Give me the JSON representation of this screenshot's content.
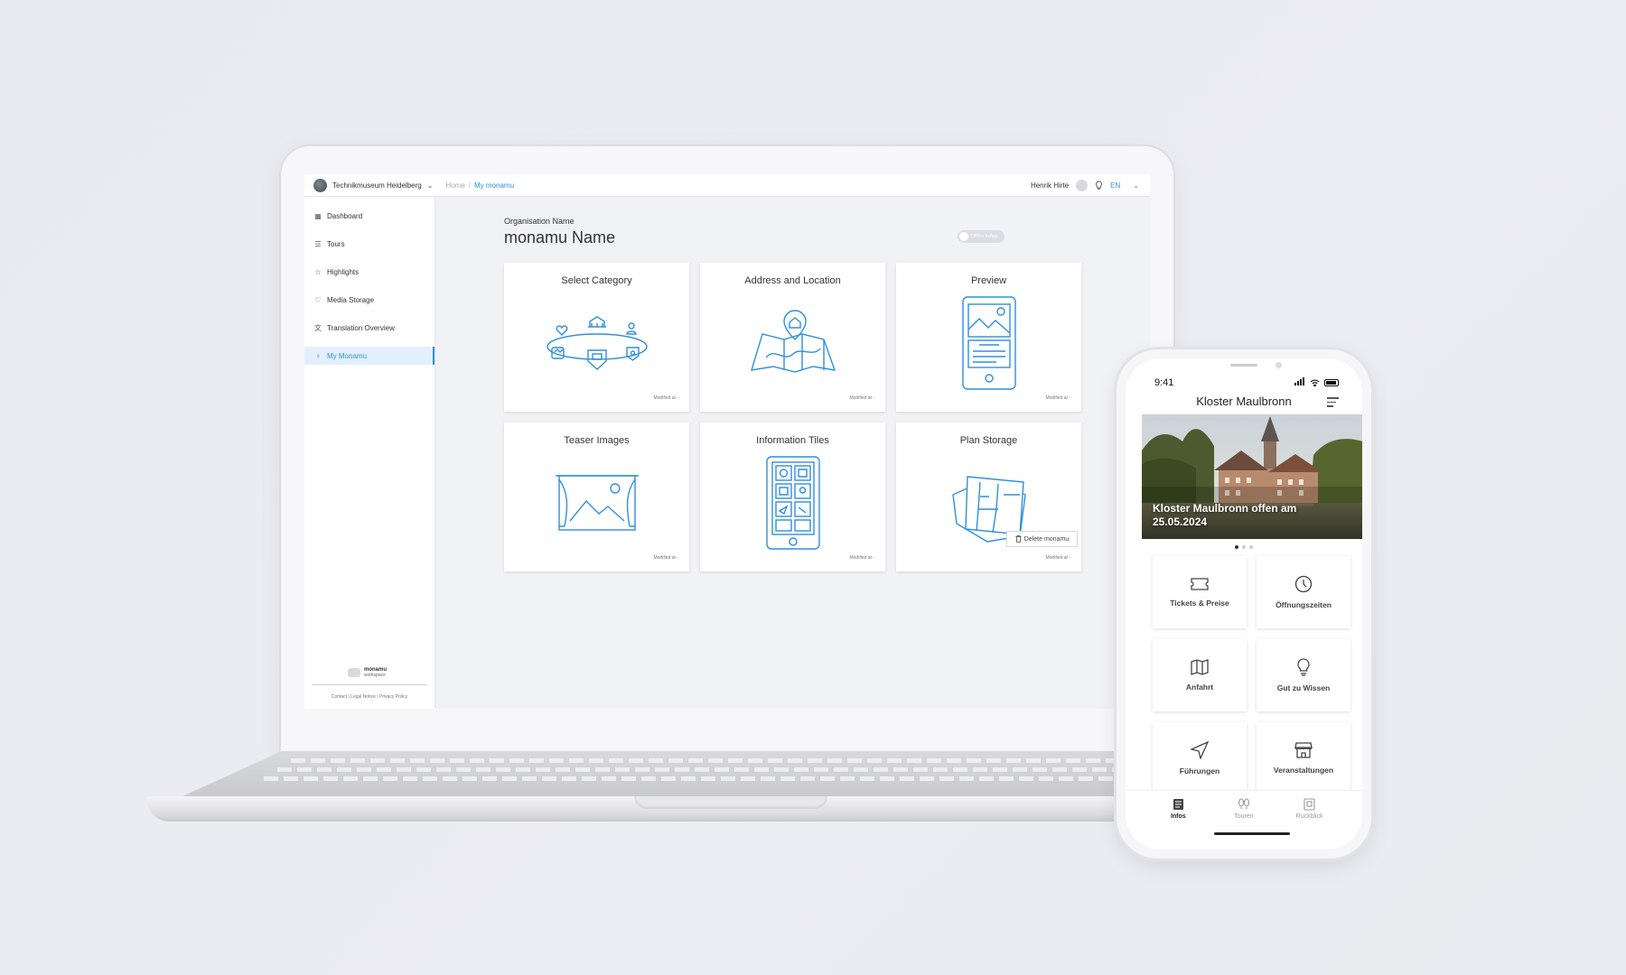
{
  "laptop": {
    "header": {
      "org_name": "Technikmuseum Heidelberg",
      "breadcrumb_home": "Home",
      "breadcrumb_sep": "/",
      "breadcrumb_current": "My monamu",
      "user_name": "Henrik Hirte",
      "language": "EN"
    },
    "sidebar": {
      "items": [
        {
          "label": "Dashboard",
          "icon": "grid-icon"
        },
        {
          "label": "Tours",
          "icon": "list-icon"
        },
        {
          "label": "Highlights",
          "icon": "star-icon"
        },
        {
          "label": "Media Storage",
          "icon": "heart-icon"
        },
        {
          "label": "Translation Overview",
          "icon": "translate-icon"
        },
        {
          "label": "My Monamu",
          "icon": "lightbulb-icon",
          "active": true
        }
      ],
      "logo_name": "monamu",
      "logo_sub": "workspace",
      "footer": "Contact | Legal Notice | Privacy Policy"
    },
    "main": {
      "org_label": "Organisation Name",
      "title": "monamu Name",
      "offline_toggle": "Offline in App",
      "cards": [
        {
          "title": "Select Category",
          "modified": "Modified at -"
        },
        {
          "title": "Address and Location",
          "modified": "Modified at -"
        },
        {
          "title": "Preview",
          "modified": "Modified at -"
        },
        {
          "title": "Teaser Images",
          "modified": "Modified at -"
        },
        {
          "title": "Information Tiles",
          "modified": "Modified at -"
        },
        {
          "title": "Plan Storage",
          "modified": "Modified at -"
        }
      ],
      "delete_label": "Delete monamu"
    },
    "accent_color": "#2f8fe0"
  },
  "phone": {
    "time": "9:41",
    "title": "Kloster Maulbronn",
    "hero_text": "Kloster Maulbronn offen am 25.05.2024",
    "carousel_page": 1,
    "carousel_total": 3,
    "tiles": [
      {
        "label": "Tickets & Preise",
        "icon": "ticket-icon"
      },
      {
        "label": "Öffnungszeiten",
        "icon": "clock-icon"
      },
      {
        "label": "Anfahrt",
        "icon": "map-icon"
      },
      {
        "label": "Gut zu Wissen",
        "icon": "lightbulb-icon"
      },
      {
        "label": "Führungen",
        "icon": "navigation-icon"
      },
      {
        "label": "Veranstaltungen",
        "icon": "shop-icon"
      }
    ],
    "tabs": [
      {
        "label": "Infos",
        "icon": "document-icon",
        "active": true
      },
      {
        "label": "Touren",
        "icon": "footprints-icon"
      },
      {
        "label": "Rückblick",
        "icon": "history-icon"
      }
    ]
  }
}
